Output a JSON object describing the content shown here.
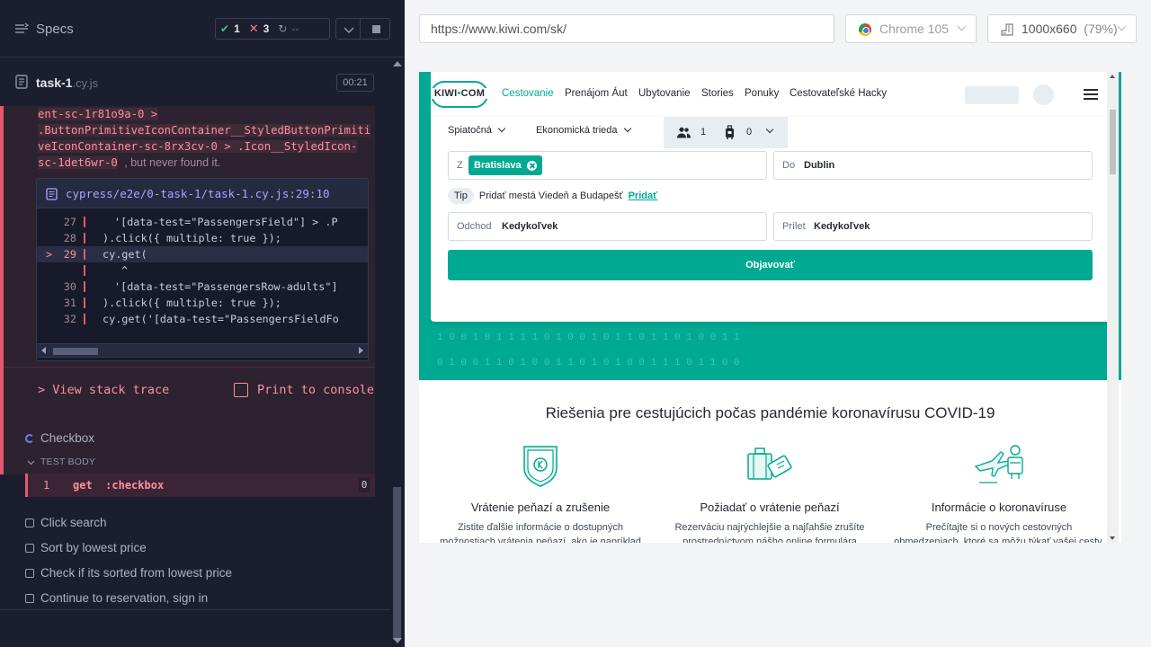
{
  "specs_bar": {
    "label": "Specs",
    "passed": "1",
    "failed": "3",
    "pending": "--"
  },
  "task": {
    "name": "task-1",
    "ext": ".cy.js",
    "duration": "00:21"
  },
  "error": {
    "line1": "ent-sc-1r81o9a-0 >",
    "line2": ".ButtonPrimitiveIconContainer__StyledButtonPrimiti",
    "line3": "veIconContainer-sc-8rx3cv-0 > .Icon__StyledIcon-",
    "line4": "sc-1det6wr-0",
    "line4_tail": ", but never found it.",
    "file_path": "cypress/e2e/0-task-1/task-1.cy.js:29:10",
    "view_stack_trace": "View stack trace",
    "print_to_console": "Print to console"
  },
  "code_lines": [
    {
      "num": "27",
      "text": "'[data-test=\"PassengersField\"] > .P"
    },
    {
      "num": "28",
      "text": ").click({ multiple: true });"
    },
    {
      "num": "29",
      "text": "cy.get("
    },
    {
      "num": "",
      "text": "^"
    },
    {
      "num": "30",
      "text": "'[data-test=\"PassengersRow-adults\"]"
    },
    {
      "num": "31",
      "text": ").click({ multiple: true });"
    },
    {
      "num": "32",
      "text": "cy.get('[data-test=\"PassengersFieldFo"
    }
  ],
  "tests": {
    "running": "Checkbox",
    "body_label": "TEST BODY",
    "command": {
      "num": "1",
      "name": "get",
      "arg": ":checkbox",
      "count": "0"
    },
    "pending": [
      "Click search",
      "Sort by lowest price",
      "Check if its sorted from lowest price",
      "Continue to reservation, sign in"
    ]
  },
  "toolbar": {
    "url": "https://www.kiwi.com/sk/",
    "browser": "Chrome 105",
    "viewport": "1000x660",
    "scale": "(79%)"
  },
  "kiwi": {
    "logo_left": "KIWI",
    "logo_dot": "•",
    "logo_right": "COM",
    "nav": [
      "Cestovanie",
      "Prenájom Áut",
      "Ubytovanie",
      "Stories",
      "Ponuky",
      "Cestovateľské Hacky"
    ],
    "trip_type": "Spiatočná",
    "cabin_class": "Ekonomická trieda",
    "passengers": "1",
    "bags": "0",
    "from_label": "Z",
    "from_chip": "Bratislava",
    "to_label": "Do",
    "to_value": "Dublin",
    "tip_badge": "Tip",
    "tip_text": "Pridať mestá Viedeň a Budapešť",
    "tip_link": "Pridať",
    "depart_label": "Odchod",
    "depart_value": "Kedykoľvek",
    "arrive_label": "Prílet",
    "arrive_value": "Kedykoľvek",
    "search_button": "Objavovať",
    "binary_row1": "1   0   0   1   0   1   1   1   1   0   1   0   0   1   0   1   1   0   1   1   0   1   0   0   1   1",
    "binary_row2": "0   1   0   0   1   1   0   1   0   0   1   1   0   1   0   1   0   0   1   1   1   0   1   1   0   0",
    "covid_title": "Riešenia pre cestujúcich počas pandémie koronavírusu COVID-19",
    "features": [
      {
        "title": "Vrátenie peňazí a zrušenie",
        "line1": "Zistite ďalšie informácie o dostupných",
        "line2": "možnostiach vrátenia peňazí, ako je napríklad"
      },
      {
        "title": "Požiadať o vrátenie peňazí",
        "line1": "Rezerváciu najrýchlejšie a najľahšie zrušíte",
        "line2": "prostredníctvom nášho online formulára"
      },
      {
        "title": "Informácie o koronavíruse",
        "line1": "Prečítajte si o nových cestovných",
        "line2": "obmedzeniach, ktoré sa môžu týkať vašej cesty."
      }
    ]
  },
  "colors": {
    "accent": "#00a991",
    "error": "#e45770",
    "panel_bg": "#1b1e2e"
  }
}
